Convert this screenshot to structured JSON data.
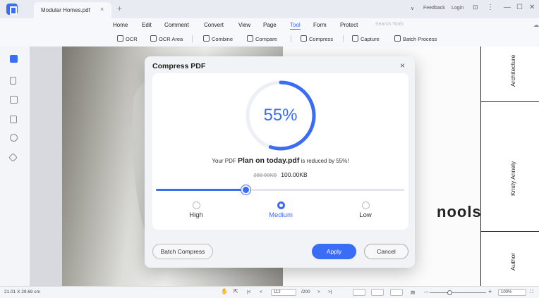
{
  "titlebar": {
    "tab_title": "Modular Homes.pdf",
    "tab_close": "×",
    "new_tab": "+",
    "chevron": "∨",
    "feedback": "Feedback",
    "login": "Login",
    "window_minimize": "—",
    "window_maximize": "☐",
    "window_close": "✕"
  },
  "menubar": {
    "items": [
      "Home",
      "Edit",
      "Comment",
      "Convert",
      "View",
      "Page",
      "Tool",
      "Form",
      "Protect"
    ],
    "active": "Tool",
    "search_placeholder": "Search Tools"
  },
  "toolbar": {
    "tools": [
      "OCR",
      "OCR Area",
      "Combine",
      "Compare",
      "Compress",
      "Capture",
      "Batch Process"
    ]
  },
  "sidebar": {
    "icons": [
      "thumbnails-icon",
      "bookmark-icon",
      "comment-icon",
      "attachment-icon",
      "search-icon",
      "layers-icon"
    ]
  },
  "document": {
    "big_text": "nools",
    "spine": {
      "top": "Architecture",
      "middle": "Kristy Annely",
      "bottom": "Author"
    }
  },
  "dialog": {
    "title": "Compress PDF",
    "close": "×",
    "percent_label": "55%",
    "percent_value": 55,
    "message_prefix": "Your PDF ",
    "file_name": "Plan on today.pdf",
    "message_suffix": " is reduced by 55%!",
    "old_size": "200.00KB",
    "new_size": "100.00KB",
    "slider_level": 0.36,
    "options": [
      "High",
      "Medium",
      "Low"
    ],
    "selected_option": "Medium",
    "batch_label": "Batch Compress",
    "apply_label": "Apply",
    "cancel_label": "Cancel"
  },
  "statusbar": {
    "dimensions": "21.01 X 29.69 cm",
    "page_current": "112",
    "page_total": "/200",
    "zoom": "100%"
  },
  "colors": {
    "accent": "#3b6cf6"
  }
}
